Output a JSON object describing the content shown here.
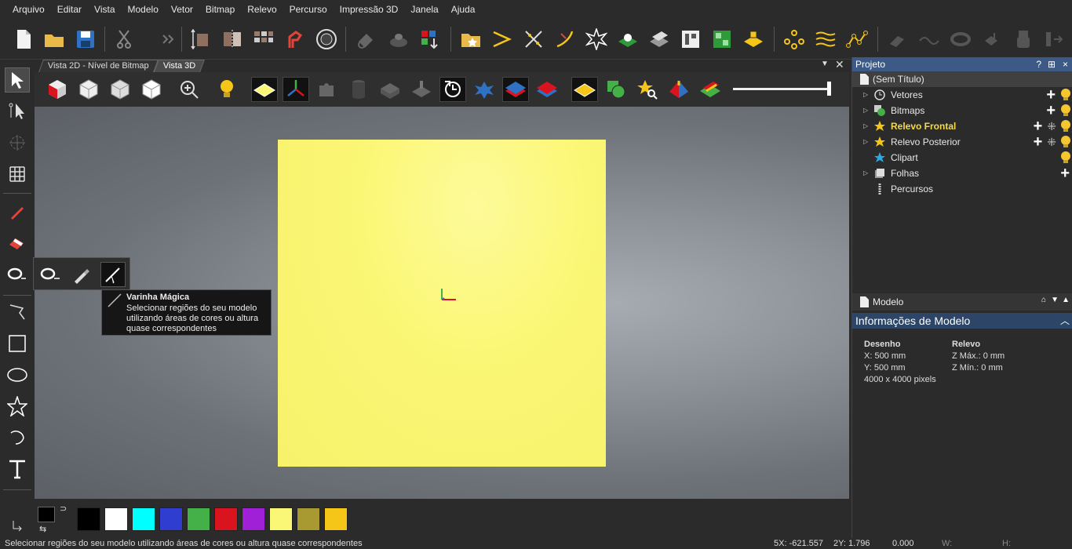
{
  "menu": [
    "Arquivo",
    "Editar",
    "Vista",
    "Modelo",
    "Vetor",
    "Bitmap",
    "Relevo",
    "Percurso",
    "Impressão 3D",
    "Janela",
    "Ajuda"
  ],
  "tabs": [
    "Vista 2D - Nível de Bitmap",
    "Vista 3D"
  ],
  "active_tab": "Vista 3D",
  "tooltip": {
    "title": "Varinha Mágica",
    "body": "Selecionar regiões do seu modelo utilizando áreas de cores ou altura quase correspondentes"
  },
  "project_panel": {
    "title": "Projeto",
    "controls": [
      "?",
      "⊞",
      "×"
    ],
    "root": "(Sem Título)",
    "items": [
      {
        "label": "Vetores",
        "icon": "vectors-icon"
      },
      {
        "label": "Bitmaps",
        "icon": "bitmaps-icon"
      },
      {
        "label": "Relevo Frontal",
        "icon": "star-icon",
        "highlight": true
      },
      {
        "label": "Relevo Posterior",
        "icon": "star-icon"
      },
      {
        "label": "Clipart",
        "icon": "clipart-star-icon"
      },
      {
        "label": "Folhas",
        "icon": "sheets-icon"
      },
      {
        "label": "Percursos",
        "icon": "toolpath-icon"
      }
    ]
  },
  "model_panel": {
    "title": "Modelo",
    "section_title": "Informações de Modelo",
    "desenho_label": "Desenho",
    "x": "X: 500 mm",
    "y": "Y: 500 mm",
    "pixels": "4000 x 4000 pixels",
    "relevo_label": "Relevo",
    "zmax": "Z Máx.: 0 mm",
    "zmin": "Z Mín.: 0 mm"
  },
  "palette": {
    "colors": [
      "#000000",
      "#ffffff",
      "#00ffff",
      "#2f3ed0",
      "#44b148",
      "#d9141e",
      "#a020d8",
      "#fbf776",
      "#a89a30",
      "#f5c518"
    ]
  },
  "status": {
    "message": "Selecionar regiões do seu modelo utilizando áreas de cores ou altura quase correspondentes",
    "x": "5X: -621.557",
    "y": "2Y: 1.796",
    "z": "0.000",
    "w": "W:",
    "h": "H:"
  },
  "colors": {
    "accent": "#3c5a85",
    "model": "#fbf776",
    "highlight": "#f6d84a"
  }
}
